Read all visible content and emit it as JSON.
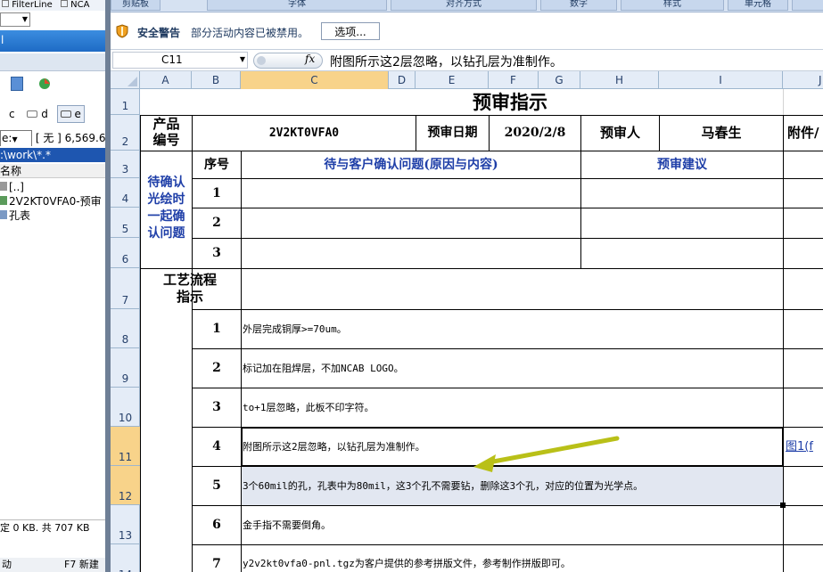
{
  "left_pane": {
    "top_labels": [
      "FilterLine",
      "NCA"
    ],
    "drive_buttons": [
      "c",
      "d",
      "e"
    ],
    "drive_select": "e:",
    "drive_info": "[ 无 ]",
    "drive_size": "6,569.6",
    "path": ":\\work\\*.*",
    "column_header": "名称",
    "files": [
      "[..]",
      "2V2KT0VFA0-预审",
      "孔表"
    ],
    "status": "定 0 KB. 共 707 KB",
    "fkeys": [
      "动",
      "F7 新建"
    ]
  },
  "ribbon": {
    "groups": [
      "剪贴板",
      "字体",
      "对齐方式",
      "数字",
      "样式",
      "单元格"
    ]
  },
  "security": {
    "title": "安全警告",
    "message": "部分活动内容已被禁用。",
    "options_label": "选项..."
  },
  "formula_bar": {
    "name_box": "C11",
    "fx": "fx",
    "content": "附图所示这2层忽略，以钻孔层为准制作。"
  },
  "columns": [
    "A",
    "B",
    "C",
    "D",
    "E",
    "F",
    "G",
    "H",
    "I",
    "J"
  ],
  "rows": [
    "1",
    "2",
    "3",
    "4",
    "5",
    "6",
    "7",
    "8",
    "9",
    "10",
    "11",
    "12",
    "13",
    "14"
  ],
  "sheet": {
    "title": "预审指示",
    "product_label": "产品\n编号",
    "product_code": "2V2KT0VFA0",
    "date_label": "预审日期",
    "date_value": "2020/2/8",
    "reviewer_label": "预审人",
    "reviewer_value": "马春生",
    "attachment_label": "附件/",
    "seq_label": "序号",
    "issue_header": "待与客户确认问题(原因与内容)",
    "suggestion_header": "预审建议",
    "confirm_label": "待确认\n光绘时\n一起确\n认问题",
    "confirm_rows": [
      "1",
      "2",
      "3"
    ],
    "process_label": "工艺流程\n指示",
    "process_rows": [
      {
        "no": "1",
        "text": "外层完成铜厚>=70um。"
      },
      {
        "no": "2",
        "text": "标记加在阻焊层，不加NCAB LOGO。"
      },
      {
        "no": "3",
        "text": "to+1层忽略，此板不印字符。"
      },
      {
        "no": "4",
        "text": "附图所示这2层忽略，以钻孔层为准制作。"
      },
      {
        "no": "5",
        "text": "3个60mil的孔，孔表中为80mil，这3个孔不需要钻，删除这3个孔，对应的位置为光学点。"
      },
      {
        "no": "6",
        "text": "金手指不需要倒角。"
      },
      {
        "no": "7",
        "text": "y2v2kt0vfa0-pnl.tgz为客户提供的参考拼版文件，参考制作拼版即可。"
      }
    ],
    "link_text": "图1(f"
  },
  "colors": {
    "header_bg": "#e4ecf7",
    "selected_header": "#f8d38a",
    "blue_text": "#1f3fa8",
    "arrow": "#b9c018",
    "selection_fill": "#e2e7f1"
  }
}
